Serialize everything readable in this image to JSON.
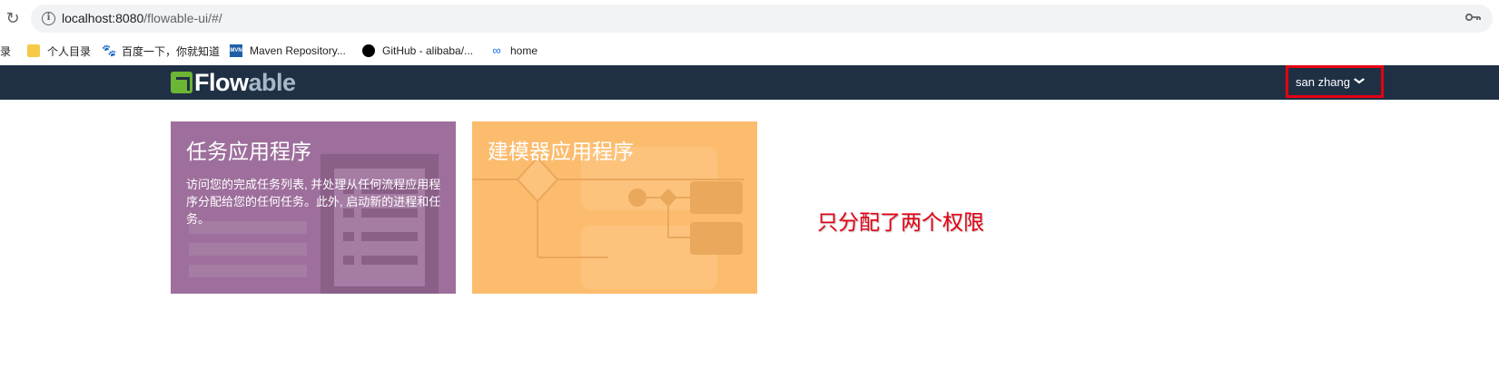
{
  "browser": {
    "url_host": "localhost:8080",
    "url_path": "/flowable-ui/#/"
  },
  "bookmarks": [
    {
      "label": "录",
      "icon": "folder-icon"
    },
    {
      "label": "个人目录",
      "icon": "folder-icon"
    },
    {
      "label": "百度一下，你就知道",
      "icon": "baidu-icon"
    },
    {
      "label": "Maven Repository...",
      "icon": "maven-icon"
    },
    {
      "label": "GitHub - alibaba/...",
      "icon": "github-icon"
    },
    {
      "label": "home",
      "icon": "home-icon"
    }
  ],
  "navbar": {
    "logo_flow": "Flow",
    "logo_able": "able",
    "user_name": "san zhang",
    "user_chevron": "❯"
  },
  "tiles": [
    {
      "title": "任务应用程序",
      "description": "访问您的完成任务列表, 并处理从任何流程应用程序分配给您的任何任务。此外, 启动新的进程和任务。",
      "color": "#9e6f9c"
    },
    {
      "title": "建模器应用程序",
      "description": "",
      "color": "#fcbc6e"
    }
  ],
  "annotation": "只分配了两个权限",
  "colors": {
    "navbar": "#1f3044",
    "highlight": "#e60012",
    "logo_green": "#6cb535"
  }
}
